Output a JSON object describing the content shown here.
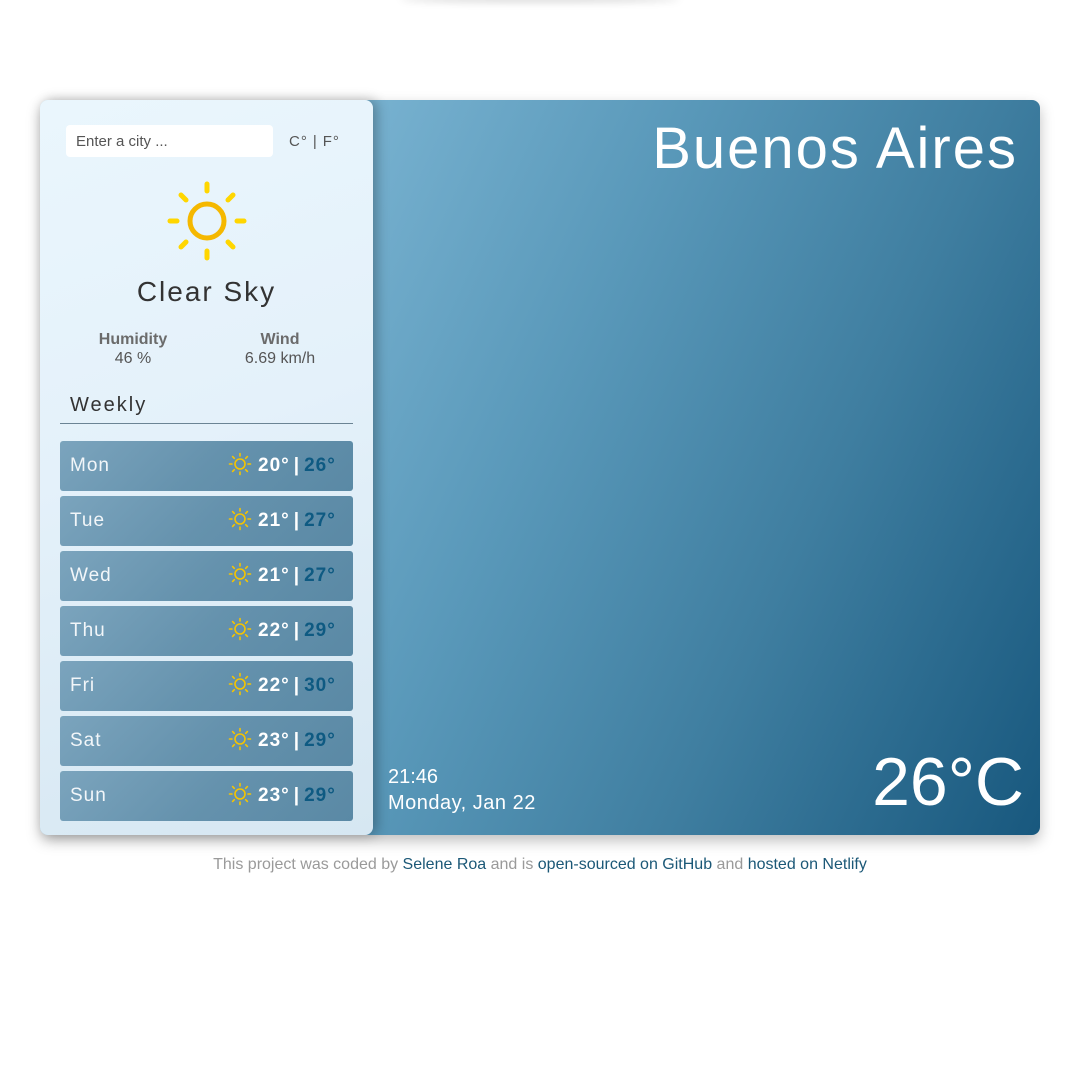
{
  "search": {
    "placeholder": "Enter a city ..."
  },
  "units": {
    "celsius": "C°",
    "separator": "|",
    "fahrenheit": "F°"
  },
  "current": {
    "icon": "sun-icon",
    "condition": "Clear Sky",
    "humidity_label": "Humidity",
    "humidity_value": "46 %",
    "wind_label": "Wind",
    "wind_value": "6.69 km/h",
    "city": "Buenos Aires",
    "time": "21:46",
    "date": "Monday, Jan 22",
    "temperature": "26°C"
  },
  "weekly": {
    "title": "Weekly",
    "separator": "|",
    "days": [
      {
        "name": "Mon",
        "icon": "sun-icon",
        "min": "20°",
        "max": "26°"
      },
      {
        "name": "Tue",
        "icon": "sun-icon",
        "min": "21°",
        "max": "27°"
      },
      {
        "name": "Wed",
        "icon": "sun-icon",
        "min": "21°",
        "max": "27°"
      },
      {
        "name": "Thu",
        "icon": "sun-icon",
        "min": "22°",
        "max": "29°"
      },
      {
        "name": "Fri",
        "icon": "sun-icon",
        "min": "22°",
        "max": "30°"
      },
      {
        "name": "Sat",
        "icon": "sun-icon",
        "min": "23°",
        "max": "29°"
      },
      {
        "name": "Sun",
        "icon": "sun-icon",
        "min": "23°",
        "max": "29°"
      }
    ]
  },
  "footer": {
    "text1": "This project was coded by ",
    "author_link": "Selene Roa",
    "text2": " and is ",
    "github_link": "open-sourced on GitHub",
    "text3": " and ",
    "netlify_link": "hosted on Netlify"
  },
  "colors": {
    "accent": "#1b5877",
    "max_temp": "#0e5a82",
    "sun": "#ffd600"
  }
}
